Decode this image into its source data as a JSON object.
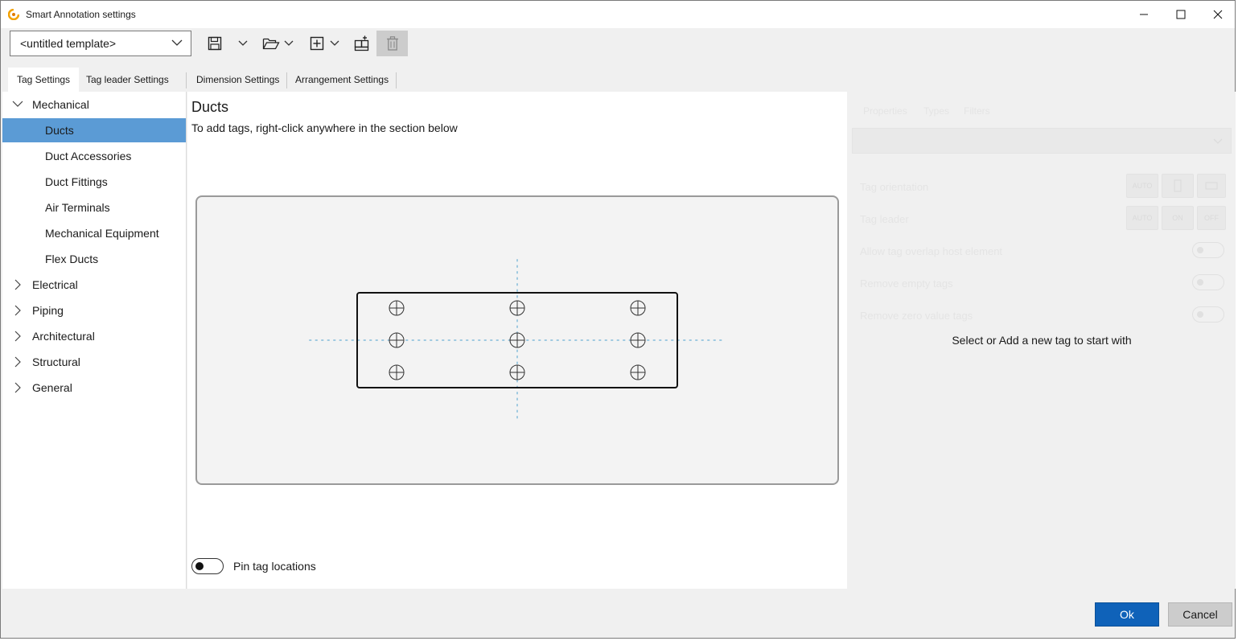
{
  "window": {
    "title": "Smart Annotation settings"
  },
  "toolbar": {
    "template_value": "<untitled template>",
    "icons": [
      "save-icon",
      "open-folder-icon",
      "add-icon",
      "add-element-icon",
      "delete-icon"
    ]
  },
  "tabs": [
    {
      "label": "Tag Settings",
      "active": true
    },
    {
      "label": "Tag leader Settings",
      "active": false
    },
    {
      "label": "Dimension Settings",
      "active": false
    },
    {
      "label": "Arrangement Settings",
      "active": false
    }
  ],
  "tree": {
    "groups": [
      {
        "label": "Mechanical",
        "expanded": true
      },
      {
        "label": "Electrical",
        "expanded": false
      },
      {
        "label": "Piping",
        "expanded": false
      },
      {
        "label": "Architectural",
        "expanded": false
      },
      {
        "label": "Structural",
        "expanded": false
      },
      {
        "label": "General",
        "expanded": false
      }
    ],
    "mechanical_children": [
      "Ducts",
      "Duct Accessories",
      "Duct Fittings",
      "Air Terminals",
      "Mechanical Equipment",
      "Flex Ducts"
    ],
    "selected": "Ducts"
  },
  "main": {
    "title": "Ducts",
    "description": "To add tags, right-click anywhere in the section below",
    "pin_label": "Pin tag locations",
    "pin_enabled": false
  },
  "right_panel": {
    "ghost_tabs": [
      "Properties",
      "Types",
      "Filters"
    ],
    "ghost_rows": [
      "Tag orientation",
      "Tag leader",
      "Allow tag overlap host element",
      "Remove empty tags",
      "Remove zero value tags"
    ],
    "ghost_buttons_orientation": [
      "AUTO",
      "",
      ""
    ],
    "ghost_buttons_leader": [
      "AUTO",
      "ON",
      "OFF"
    ],
    "message": "Select or Add a new tag to start with"
  },
  "footer": {
    "ok_label": "Ok",
    "cancel_label": "Cancel"
  },
  "colors": {
    "accent": "#0f62b9",
    "selection": "#5b9bd5",
    "guide": "#9ec9e0"
  }
}
